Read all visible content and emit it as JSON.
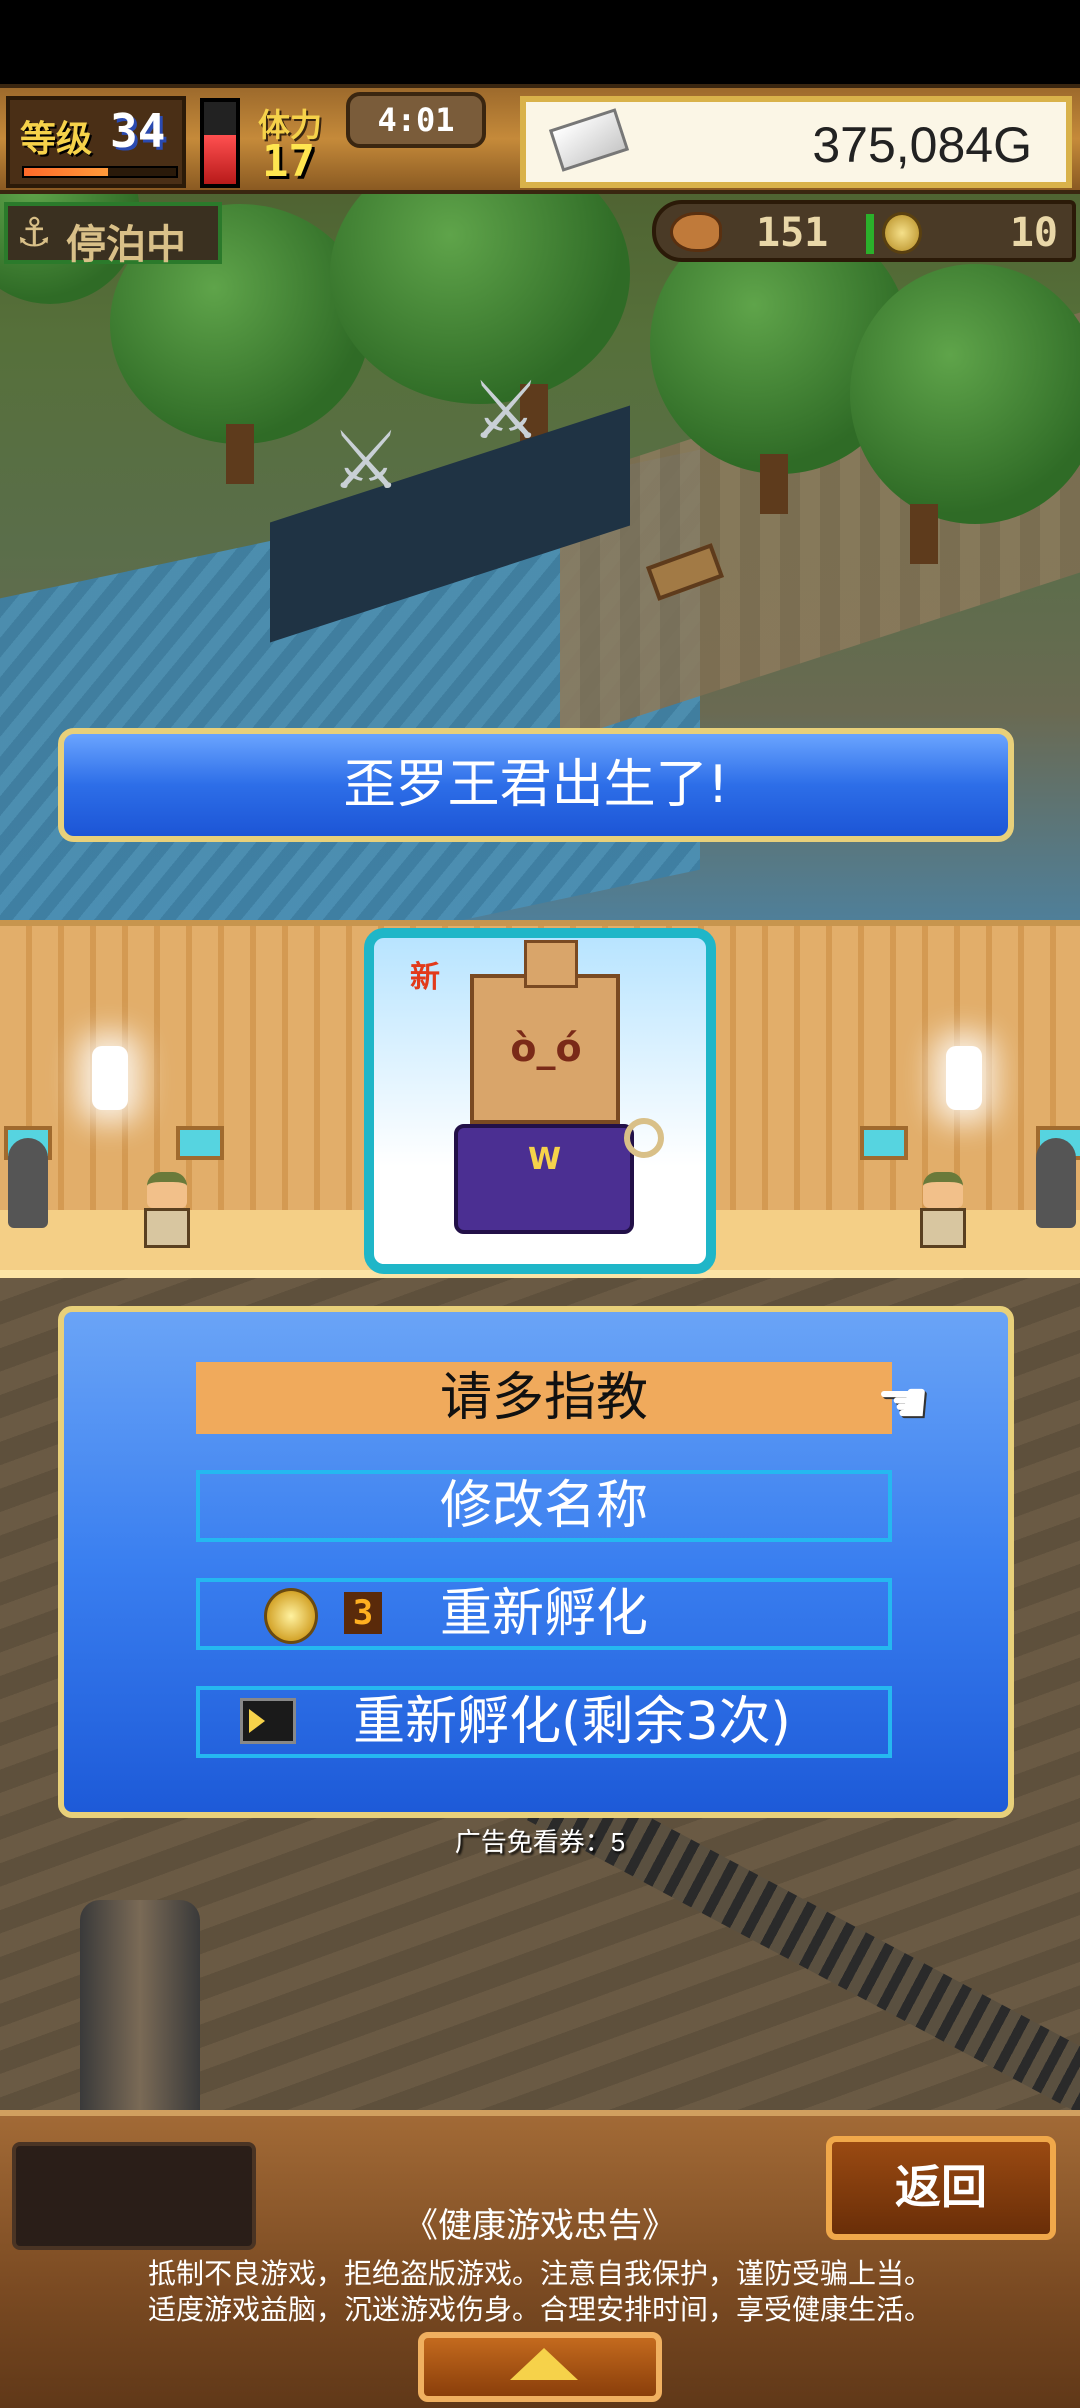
{
  "hud": {
    "level_label": "等级",
    "level_value": "34",
    "exp_fraction": 0.55,
    "stamina_label": "体力",
    "stamina_value": "17",
    "stamina_fraction": 0.6,
    "clock": "4:01",
    "money": "375,084G",
    "money_icon": "silver-bar-icon"
  },
  "status": {
    "anchor_icon": "⚓",
    "anchor_text": "停泊中"
  },
  "resources": {
    "food_icon": "roast-meat-icon",
    "food_value": "151",
    "coin_icon": "coin-icon",
    "coin_value": "10"
  },
  "banner": {
    "message": "歪罗王君出生了!"
  },
  "character": {
    "new_badge": "新",
    "face": "ò_ó",
    "emblem": "W"
  },
  "menu": {
    "items": [
      {
        "label": "请多指教",
        "selected": true
      },
      {
        "label": "修改名称"
      },
      {
        "label": "重新孵化",
        "cost": "3",
        "cost_icon": "coin-icon"
      },
      {
        "label": "重新孵化(剩余3次)",
        "icon": "video-ad-icon"
      }
    ],
    "pointer_icon": "pointing-hand-icon",
    "pointer_glyph": "☚"
  },
  "ticket": {
    "text": "广告免看券：5"
  },
  "bottom": {
    "back_label": "返回",
    "notice_title": "《健康游戏忠告》",
    "notice_line1": "抵制不良游戏，拒绝盗版游戏。注意自我保护，谨防受骗上当。",
    "notice_line2": "适度游戏益脑，沉迷游戏伤身。合理安排时间，享受健康生活。"
  },
  "colors": {
    "menu_selected": "#f0aa5c",
    "menu_border": "#25b8f0",
    "banner_blue": "#2d6ee8",
    "gold_trim": "#e8d07a"
  }
}
